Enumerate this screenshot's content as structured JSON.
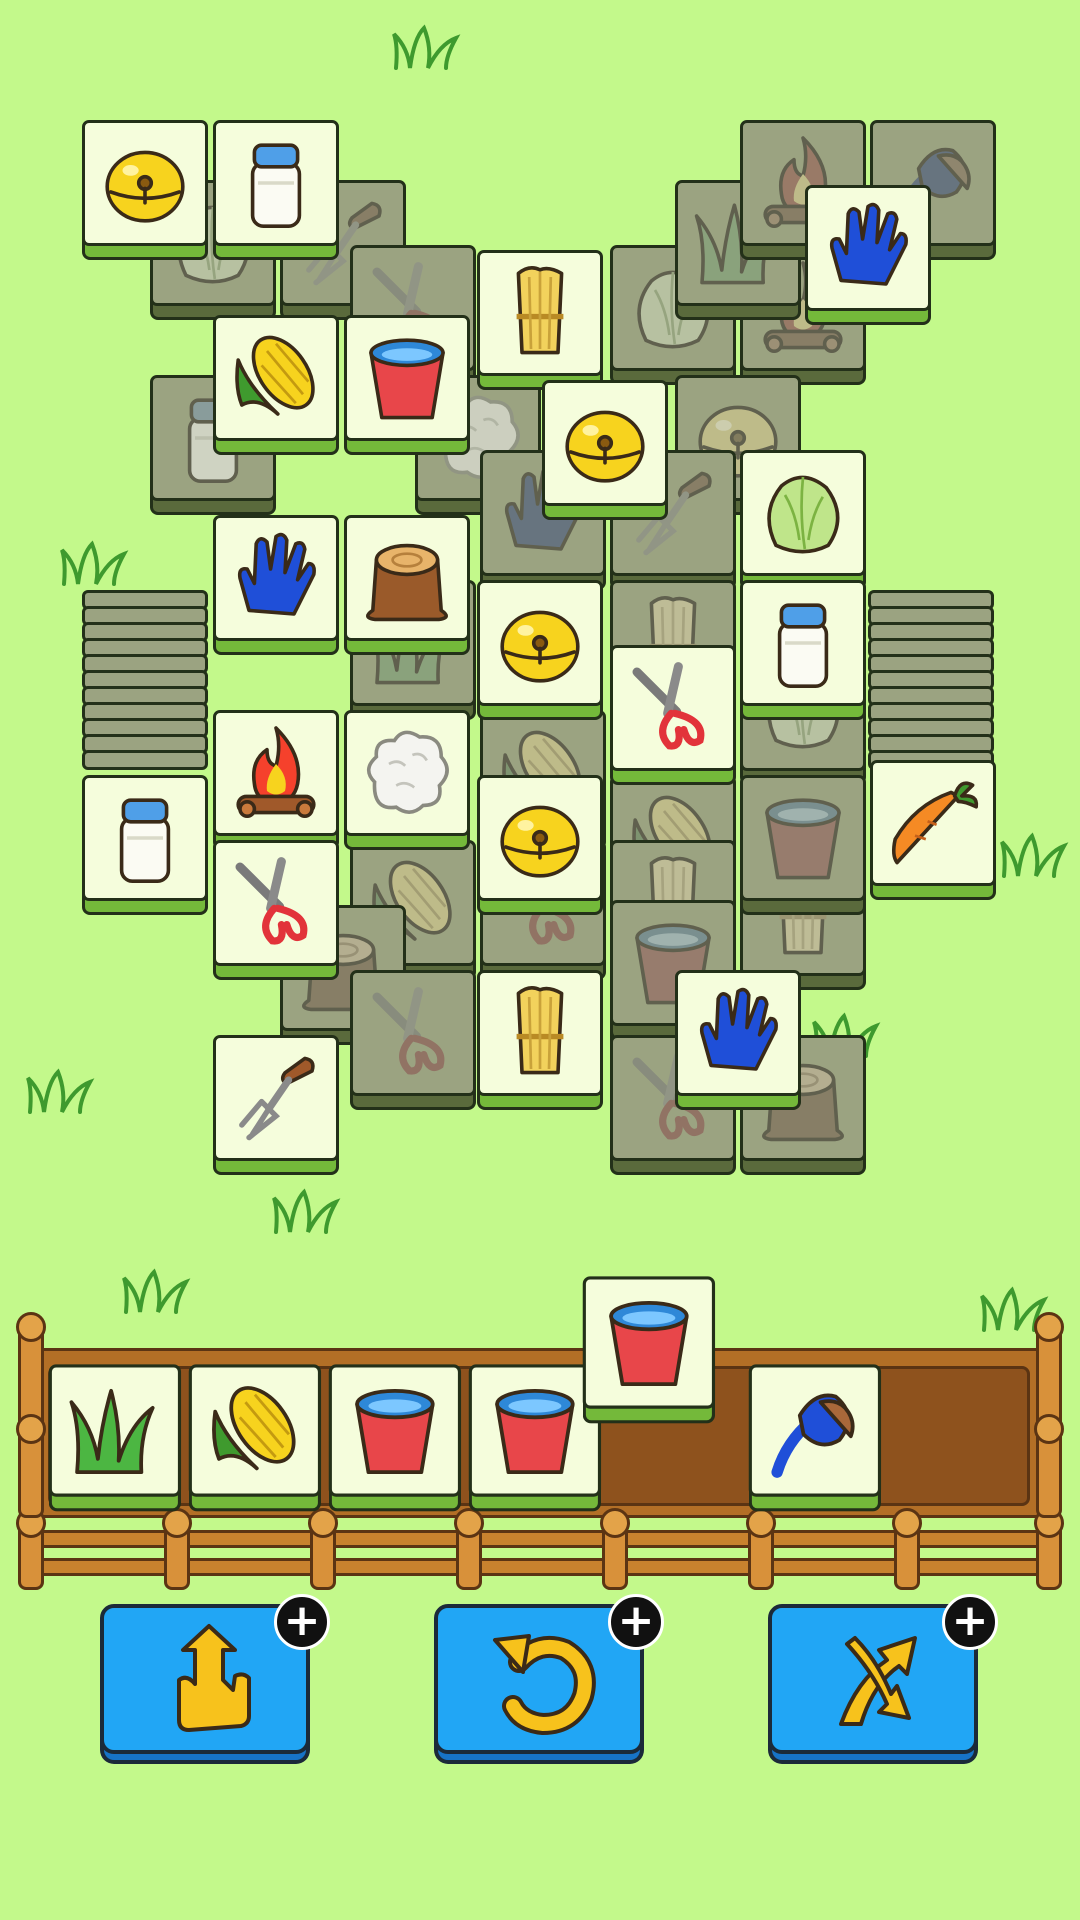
{
  "game": {
    "name": "tile-match-farm"
  },
  "colors": {
    "background": "#c3f98b",
    "tile_face": "#f5fddc",
    "tile_base": "#74b93a",
    "blocked_face": "#9ba381",
    "button": "#21a6f5",
    "fence": "#c8822e"
  },
  "icons": {
    "bell": "bell-icon",
    "milk": "milk-bottle-icon",
    "corn": "corn-icon",
    "bucket": "water-bucket-icon",
    "wheat": "wheat-bundle-icon",
    "glove": "blue-glove-icon",
    "stump": "tree-stump-icon",
    "shears": "pruning-shears-icon",
    "fire": "campfire-icon",
    "wool": "wool-ball-icon",
    "carrot": "carrot-icon",
    "fork": "garden-fork-icon",
    "grass": "grass-tuft-icon",
    "brush": "brush-icon",
    "cabbage": "cabbage-icon"
  },
  "board": {
    "tiles": [
      {
        "icon": "cabbage",
        "state": "blocked"
      },
      {
        "icon": "fork",
        "state": "blocked"
      },
      {
        "icon": "shears",
        "state": "blocked"
      },
      {
        "icon": "cabbage",
        "state": "blocked"
      },
      {
        "icon": "fire",
        "state": "blocked"
      },
      {
        "icon": "brush",
        "state": "blocked"
      },
      {
        "icon": "grass",
        "state": "blocked"
      },
      {
        "icon": "fire",
        "state": "blocked"
      },
      {
        "icon": "milk",
        "state": "blocked"
      },
      {
        "icon": "wool",
        "state": "blocked"
      },
      {
        "icon": "bell",
        "state": "blocked"
      },
      {
        "icon": "fork",
        "state": "blocked"
      },
      {
        "icon": "glove",
        "state": "blocked"
      },
      {
        "icon": "wheat",
        "state": "blocked"
      },
      {
        "icon": "grass",
        "state": "blocked"
      },
      {
        "icon": "wheat",
        "state": "blocked"
      },
      {
        "icon": "corn",
        "state": "blocked"
      },
      {
        "icon": "cabbage",
        "state": "blocked"
      },
      {
        "icon": "bucket",
        "state": "blocked"
      },
      {
        "icon": "corn",
        "state": "blocked"
      },
      {
        "icon": "corn",
        "state": "blocked"
      },
      {
        "icon": "shears",
        "state": "blocked"
      },
      {
        "icon": "brush",
        "state": "blocked"
      },
      {
        "icon": "wheat",
        "state": "blocked"
      },
      {
        "icon": "stump",
        "state": "blocked"
      },
      {
        "icon": "shears",
        "state": "blocked"
      },
      {
        "icon": "bucket",
        "state": "blocked"
      },
      {
        "icon": "bucket",
        "state": "blocked"
      },
      {
        "icon": "shears",
        "state": "blocked"
      },
      {
        "icon": "stump",
        "state": "blocked"
      },
      {
        "icon": "bell",
        "state": "open"
      },
      {
        "icon": "milk",
        "state": "open"
      },
      {
        "icon": "glove",
        "state": "open"
      },
      {
        "icon": "wheat",
        "state": "open"
      },
      {
        "icon": "corn",
        "state": "open"
      },
      {
        "icon": "bucket",
        "state": "open"
      },
      {
        "icon": "bell",
        "state": "open"
      },
      {
        "icon": "cabbage",
        "state": "open"
      },
      {
        "icon": "glove",
        "state": "open"
      },
      {
        "icon": "stump",
        "state": "open"
      },
      {
        "icon": "bell",
        "state": "open"
      },
      {
        "icon": "milk",
        "state": "open"
      },
      {
        "icon": "shears",
        "state": "open"
      },
      {
        "icon": "fire",
        "state": "open"
      },
      {
        "icon": "wool",
        "state": "open"
      },
      {
        "icon": "bell",
        "state": "open"
      },
      {
        "icon": "milk",
        "state": "open"
      },
      {
        "icon": "carrot",
        "state": "open"
      },
      {
        "icon": "shears",
        "state": "open"
      },
      {
        "icon": "wheat",
        "state": "open"
      },
      {
        "icon": "glove",
        "state": "open"
      },
      {
        "icon": "fork",
        "state": "open"
      }
    ]
  },
  "tray": {
    "slots_total": 7,
    "tiles": [
      "grass",
      "corn",
      "bucket",
      "bucket",
      "bucket",
      "brush"
    ]
  },
  "actions": [
    {
      "name": "pull-out-button",
      "icon": "pull-out-icon",
      "badge": "+"
    },
    {
      "name": "undo-button",
      "icon": "undo-icon",
      "badge": "+"
    },
    {
      "name": "shuffle-button",
      "icon": "shuffle-icon",
      "badge": "+"
    }
  ]
}
